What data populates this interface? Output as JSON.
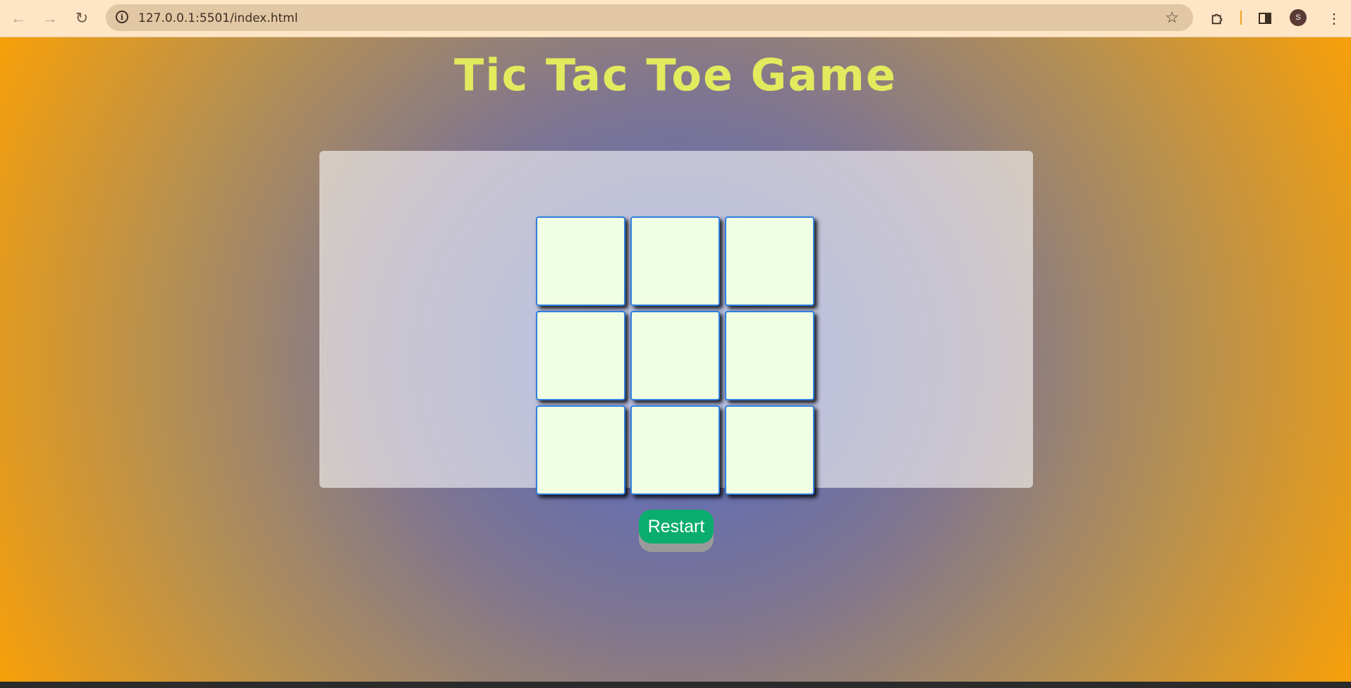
{
  "browser": {
    "back_icon": "back-arrow-icon",
    "forward_icon": "forward-arrow-icon",
    "reload_icon": "reload-icon",
    "address": "127.0.0.1:5501/index.html",
    "bookmark_icon": "star-icon",
    "extensions_icon": "puzzle-icon",
    "sidepanel_icon": "side-panel-icon",
    "profile_initial": "S",
    "menu_icon": "kebab-menu-icon"
  },
  "game": {
    "title": "Tic Tac Toe Game",
    "cells": [
      "",
      "",
      "",
      "",
      "",
      "",
      "",
      "",
      ""
    ],
    "restart_label": "Restart"
  },
  "colors": {
    "title": "#e2ea5e",
    "cell_background": "#f0ffe4",
    "cell_border": "#2f7fe0",
    "restart_button": "#0aad6e",
    "page_center": "#4f68c9",
    "page_edge": "#fca102"
  }
}
